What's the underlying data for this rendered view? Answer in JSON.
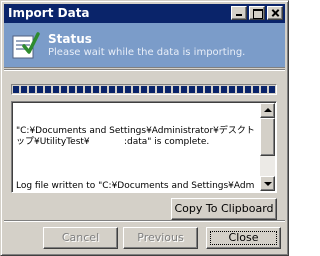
{
  "window": {
    "title": "Import Data"
  },
  "header": {
    "title": "Status",
    "subtitle": "Please wait while the data is importing.",
    "icon": "import-status-icon"
  },
  "progress": {
    "percent": 100
  },
  "log": {
    "lines": [
      "\"C:¥Documents and Settings¥Administrator¥デスクトップ¥UtilityTest¥            :data\" is complete.",
      "Log file written to \"C:¥Documents and Settings¥Administrator¥デスクトップ¥UtilityTest¥CRM Configuration Data Utility.log\"."
    ]
  },
  "buttons": {
    "copy": "Copy To Clipboard",
    "cancel": "Cancel",
    "previous": "Previous",
    "close": "Close"
  },
  "colors": {
    "title_bar": "#0a246a",
    "header_band": "#7b9cc9",
    "progress": "#0a246a",
    "face": "#d4d0c8"
  }
}
